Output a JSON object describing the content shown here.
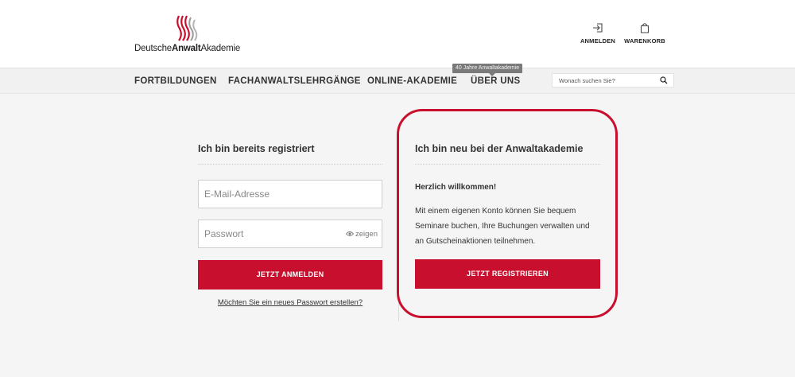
{
  "header": {
    "logo": {
      "text_regular_1": "Deutsche",
      "text_bold": "Anwalt",
      "text_regular_2": "Akademie"
    },
    "login_label": "ANMELDEN",
    "cart_label": "WARENKORB"
  },
  "nav": {
    "items": [
      {
        "label": "FORTBILDUNGEN"
      },
      {
        "label": "FACHANWALTSLEHRGÄNGE"
      },
      {
        "label": "ONLINE-AKADEMIE"
      },
      {
        "label": "ÜBER UNS"
      }
    ],
    "tooltip": "40 Jahre Anwaltakademie",
    "search_placeholder": "Wonach suchen Sie?"
  },
  "login": {
    "title": "Ich bin bereits registriert",
    "email_placeholder": "E-Mail-Adresse",
    "password_placeholder": "Passwort",
    "show_label": "zeigen",
    "submit_label": "JETZT ANMELDEN",
    "forgot_link": "Möchten Sie ein neues Passwort erstellen?"
  },
  "register": {
    "title": "Ich bin neu bei der Anwaltakademie",
    "welcome": "Herzlich willkommen!",
    "description": "Mit einem eigenen Konto können Sie bequem Seminare buchen, Ihre Buchungen verwalten und an Gutscheinaktionen teilnehmen.",
    "submit_label": "JETZT REGISTRIEREN"
  },
  "colors": {
    "accent": "#c8102e",
    "background": "#f5f5f5",
    "header": "#ffffff"
  },
  "icons": {
    "login": "login-arrow-icon",
    "cart": "shopping-bag-icon",
    "search": "search-icon",
    "eye": "eye-icon"
  }
}
